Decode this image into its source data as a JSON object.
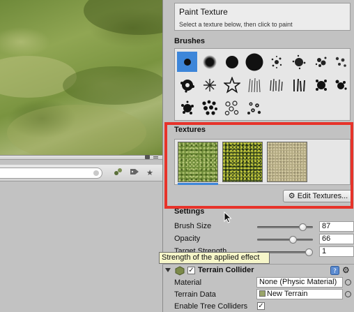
{
  "inspector": {
    "tool_title": "Paint Texture",
    "tool_help": "Select a texture below, then click to paint",
    "brushes_label": "Brushes",
    "textures_label": "Textures",
    "edit_textures_label": "Edit Textures...",
    "settings_label": "Settings",
    "settings": [
      {
        "label": "Brush Size",
        "value": "87",
        "level": 0.87
      },
      {
        "label": "Opacity",
        "value": "66",
        "level": 0.66
      },
      {
        "label": "Target Strength",
        "value": "1",
        "level": 1.0
      }
    ],
    "tooltip": "Strength of the applied effect"
  },
  "collider": {
    "title": "Terrain Collider",
    "enabled": true,
    "rows": [
      {
        "label": "Material",
        "value": "None (Physic Material)"
      },
      {
        "label": "Terrain Data",
        "value": "New Terrain"
      },
      {
        "label": "Enable Tree Colliders",
        "checked": true
      }
    ]
  },
  "colors": {
    "accent": "#3d86d9",
    "highlight": "#e7332a",
    "tooltip_bg": "#f6f6c9"
  },
  "icons": [
    "lock-icon",
    "menu-icon",
    "search-clear-icon",
    "filter-icon",
    "label-icon",
    "star-icon",
    "gear-icon",
    "help-icon",
    "object-picker-icon",
    "terrain-data-icon",
    "cursor-icon"
  ]
}
